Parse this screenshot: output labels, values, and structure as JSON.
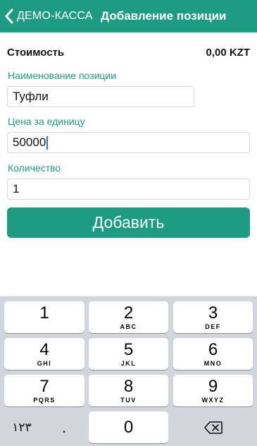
{
  "colors": {
    "accent": "#1d9c82",
    "keyboard_bg": "#d2d5db"
  },
  "header": {
    "back_label": "ДЕМО-КАССА",
    "title": "Добавление позиции"
  },
  "summary": {
    "cost_label": "Стоимость",
    "cost_value": "0,00 KZT"
  },
  "form": {
    "name": {
      "label": "Наименование позиции",
      "value": "Туфли"
    },
    "price": {
      "label": "Цена за единицу",
      "value": "50000"
    },
    "quantity": {
      "label": "Количество",
      "value": "1"
    },
    "submit_label": "Добавить"
  },
  "keyboard": {
    "keys": [
      {
        "digit": "1",
        "letters": ""
      },
      {
        "digit": "2",
        "letters": "ABC"
      },
      {
        "digit": "3",
        "letters": "DEF"
      },
      {
        "digit": "4",
        "letters": "GHI"
      },
      {
        "digit": "5",
        "letters": "JKL"
      },
      {
        "digit": "6",
        "letters": "MNO"
      },
      {
        "digit": "7",
        "letters": "PQRS"
      },
      {
        "digit": "8",
        "letters": "TUV"
      },
      {
        "digit": "9",
        "letters": "WXYZ"
      }
    ],
    "bottom": {
      "alt_label": "١٢٣",
      "decimal": ".",
      "zero": "0",
      "delete_icon": "backspace-icon"
    }
  }
}
